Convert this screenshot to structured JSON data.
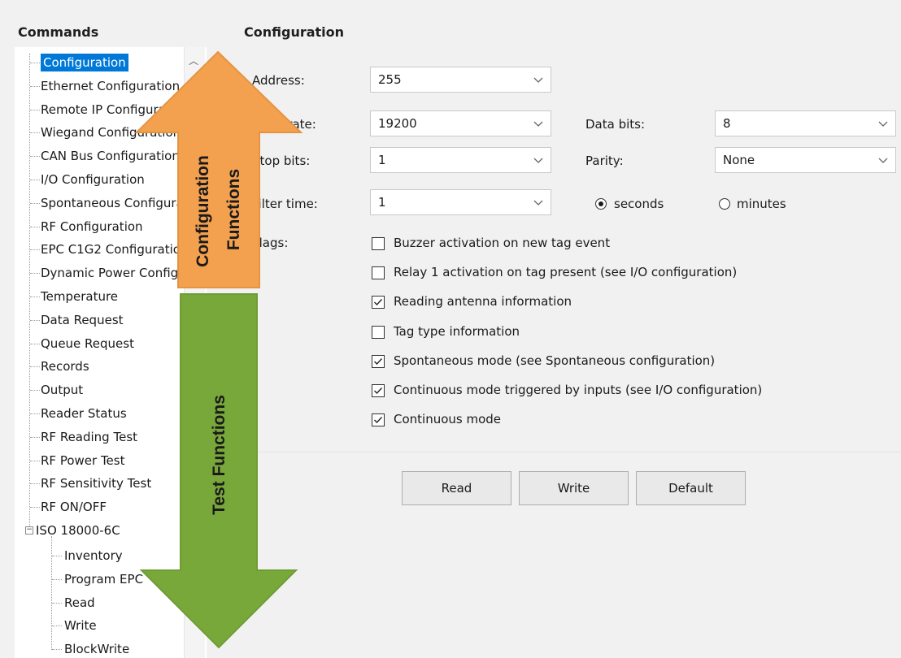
{
  "commands_title": "Commands",
  "config_title": "Configuration",
  "tree": {
    "items": [
      "Configuration",
      "Ethernet Configuration",
      "Remote IP Configuration",
      "Wiegand Configuration",
      "CAN Bus Configuration",
      "I/O Configuration",
      "Spontaneous Configuration",
      "RF Configuration",
      "EPC C1G2 Configuration",
      "Dynamic Power Configuration",
      "Temperature",
      "Data Request",
      "Queue Request",
      "Records",
      "Output",
      "Reader Status",
      "RF Reading Test",
      "RF Power Test",
      "RF Sensitivity Test",
      "RF ON/OFF",
      "ISO 18000-6C"
    ],
    "subitems": [
      "Inventory",
      "Program EPC",
      "Read",
      "Write",
      "BlockWrite"
    ]
  },
  "form": {
    "address_label": "Address:",
    "address_value": "255",
    "baudrate_label": "Baud rate:",
    "baudrate_value": "19200",
    "databits_label": "Data bits:",
    "databits_value": "8",
    "stopbits_label": "Stop bits:",
    "stopbits_value": "1",
    "parity_label": "Parity:",
    "parity_value": "None",
    "filtertime_label": "Filter time:",
    "filtertime_value": "1",
    "unit_seconds": "seconds",
    "unit_minutes": "minutes",
    "unit_selected": "seconds",
    "flags_label": "Flags:",
    "flags": [
      {
        "label": "Buzzer activation on new tag event",
        "checked": false
      },
      {
        "label": "Relay 1 activation on tag present (see I/O configuration)",
        "checked": false
      },
      {
        "label": "Reading antenna information",
        "checked": true
      },
      {
        "label": "Tag type information",
        "checked": false
      },
      {
        "label": "Spontaneous mode (see Spontaneous configuration)",
        "checked": true
      },
      {
        "label": "Continuous mode triggered by inputs (see I/O configuration)",
        "checked": true
      },
      {
        "label": "Continuous mode",
        "checked": true
      }
    ]
  },
  "buttons": {
    "read": "Read",
    "write": "Write",
    "default": "Default"
  },
  "overlay": {
    "config_line1": "Configuration",
    "config_line2": "Functions",
    "test_label": "Test Functions",
    "up_arrow_color": "#f4a14f",
    "down_arrow_color": "#79a83a"
  }
}
